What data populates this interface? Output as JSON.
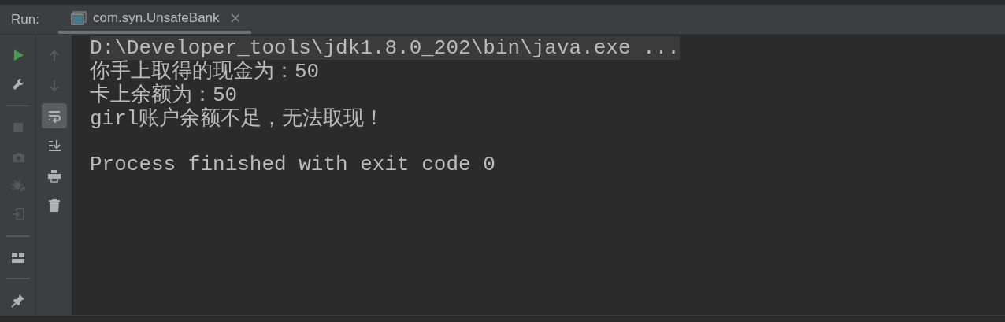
{
  "run_panel": {
    "label": "Run:",
    "tab": {
      "title": "com.syn.UnsafeBank",
      "closable": true,
      "selected": true
    }
  },
  "left_toolbar": [
    {
      "kind": "run",
      "disabled": false
    },
    {
      "kind": "wrench",
      "disabled": false
    },
    {
      "kind": "separator"
    },
    {
      "kind": "stop",
      "disabled": true
    },
    {
      "kind": "camera",
      "disabled": true
    },
    {
      "kind": "bug",
      "disabled": true
    },
    {
      "kind": "exit",
      "disabled": true
    },
    {
      "kind": "separator"
    },
    {
      "kind": "layout",
      "disabled": false
    },
    {
      "kind": "separator"
    },
    {
      "kind": "pin",
      "disabled": false
    }
  ],
  "right_toolbar": [
    {
      "kind": "up",
      "disabled": true,
      "selected": false
    },
    {
      "kind": "down",
      "disabled": true,
      "selected": false
    },
    {
      "kind": "wrap",
      "disabled": false,
      "selected": true
    },
    {
      "kind": "scroll",
      "disabled": false,
      "selected": false
    },
    {
      "kind": "print",
      "disabled": false,
      "selected": false
    },
    {
      "kind": "trash",
      "disabled": false,
      "selected": false
    }
  ],
  "console": [
    {
      "kind": "command",
      "text": "D:\\Developer_tools\\jdk1.8.0_202\\bin\\java.exe ..."
    },
    {
      "kind": "output",
      "text": "你手上取得的现金为：50"
    },
    {
      "kind": "output",
      "text": "卡上余额为：50"
    },
    {
      "kind": "output",
      "text": "girl账户余额不足，无法取现！"
    },
    {
      "kind": "blank"
    },
    {
      "kind": "output",
      "text": "Process finished with exit code 0"
    }
  ]
}
